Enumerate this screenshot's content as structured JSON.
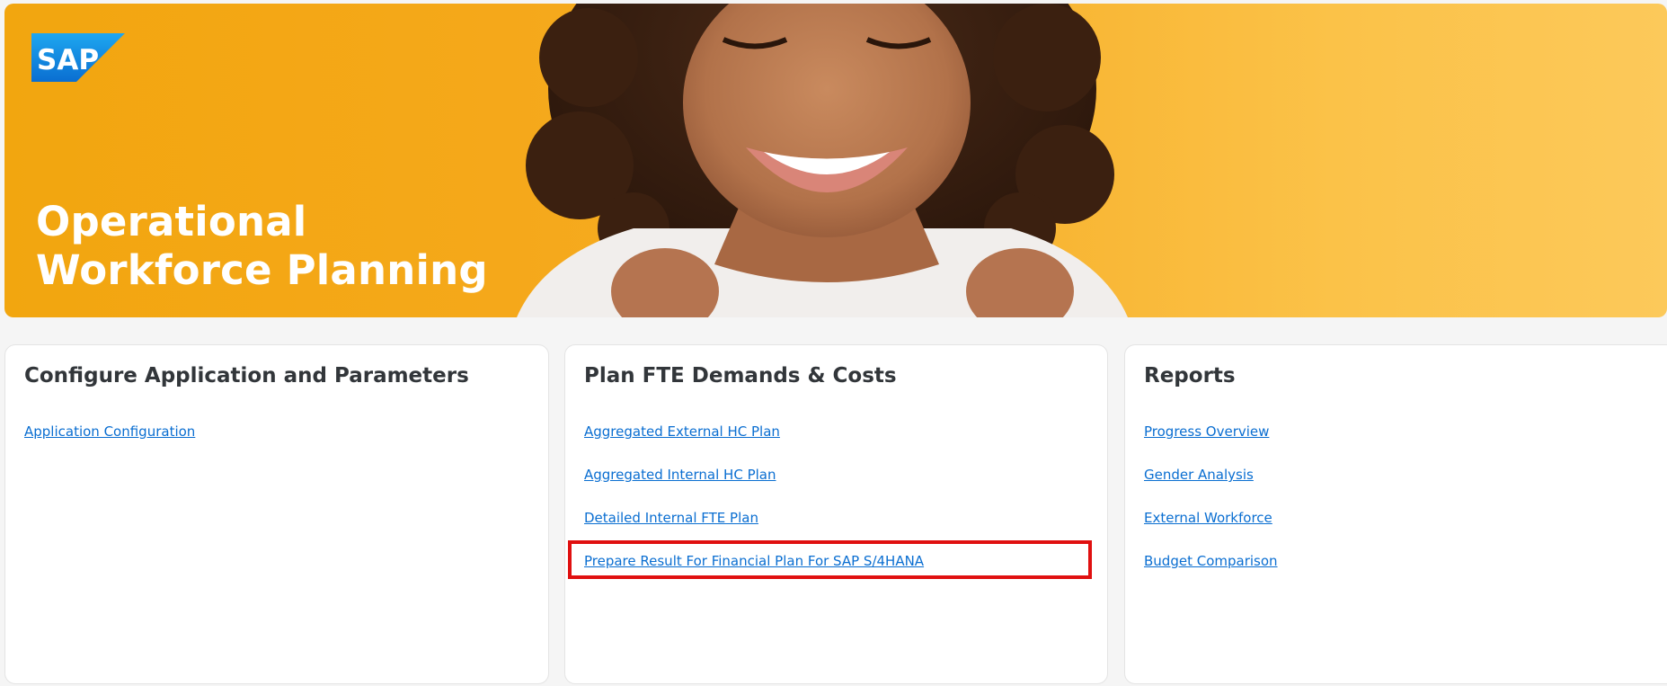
{
  "banner": {
    "logo_text": "SAP",
    "title_line1": "Operational",
    "title_line2": "Workforce Planning"
  },
  "cards": [
    {
      "title": "Configure Application and Parameters",
      "links": [
        "Application Configuration"
      ]
    },
    {
      "title": "Plan FTE Demands & Costs",
      "links": [
        "Aggregated External HC Plan",
        "Aggregated Internal HC Plan",
        "Detailed Internal FTE Plan",
        "Prepare Result For Financial Plan For SAP S/4HANA"
      ]
    },
    {
      "title": "Reports",
      "links": [
        "Progress Overview",
        "Gender Analysis",
        "External Workforce",
        "Budget Comparison"
      ]
    }
  ],
  "colors": {
    "banner_accent": "#f5a81a",
    "link": "#0a6ed1",
    "heading": "#32363a",
    "highlight": "#e01010",
    "sap_blue": "#0a6ed1"
  }
}
